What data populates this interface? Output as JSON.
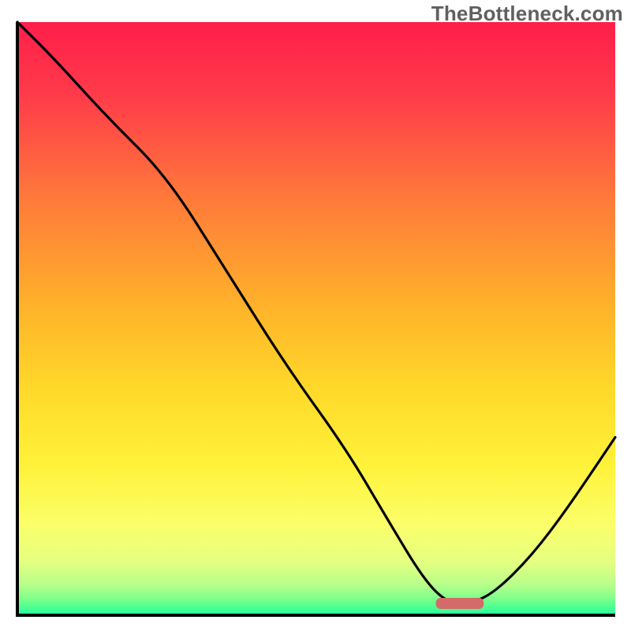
{
  "watermark": "TheBottleneck.com",
  "chart_data": {
    "type": "line",
    "title": "",
    "xlabel": "",
    "ylabel": "",
    "xlim": [
      0,
      100
    ],
    "ylim": [
      0,
      100
    ],
    "gradient_bands": [
      {
        "name": "red",
        "from": 100,
        "to": 60,
        "color_top": "#ff1e4a",
        "color_bottom": "#ff6a3a"
      },
      {
        "name": "orange",
        "from": 60,
        "to": 35,
        "color_top": "#ff9a2a",
        "color_bottom": "#ffd22a"
      },
      {
        "name": "yellow",
        "from": 35,
        "to": 12,
        "color_top": "#ffe83a",
        "color_bottom": "#fbff6a"
      },
      {
        "name": "yellow-green",
        "from": 12,
        "to": 4,
        "color_top": "#f0ff80",
        "color_bottom": "#b9ff8a"
      },
      {
        "name": "green",
        "from": 4,
        "to": 0,
        "color_top": "#7dff8a",
        "color_bottom": "#2bff99"
      }
    ],
    "series": [
      {
        "name": "curve",
        "x": [
          0,
          6,
          15,
          25,
          35,
          45,
          55,
          62,
          68,
          72,
          76,
          80,
          86,
          92,
          100
        ],
        "y": [
          100,
          94,
          84,
          74,
          58,
          42,
          28,
          16,
          6,
          2,
          2,
          4,
          10,
          18,
          30
        ]
      }
    ],
    "marker": {
      "name": "optimal-point",
      "x_center": 74,
      "x_half_width": 4,
      "y": 2,
      "color": "#d46a6a"
    }
  }
}
